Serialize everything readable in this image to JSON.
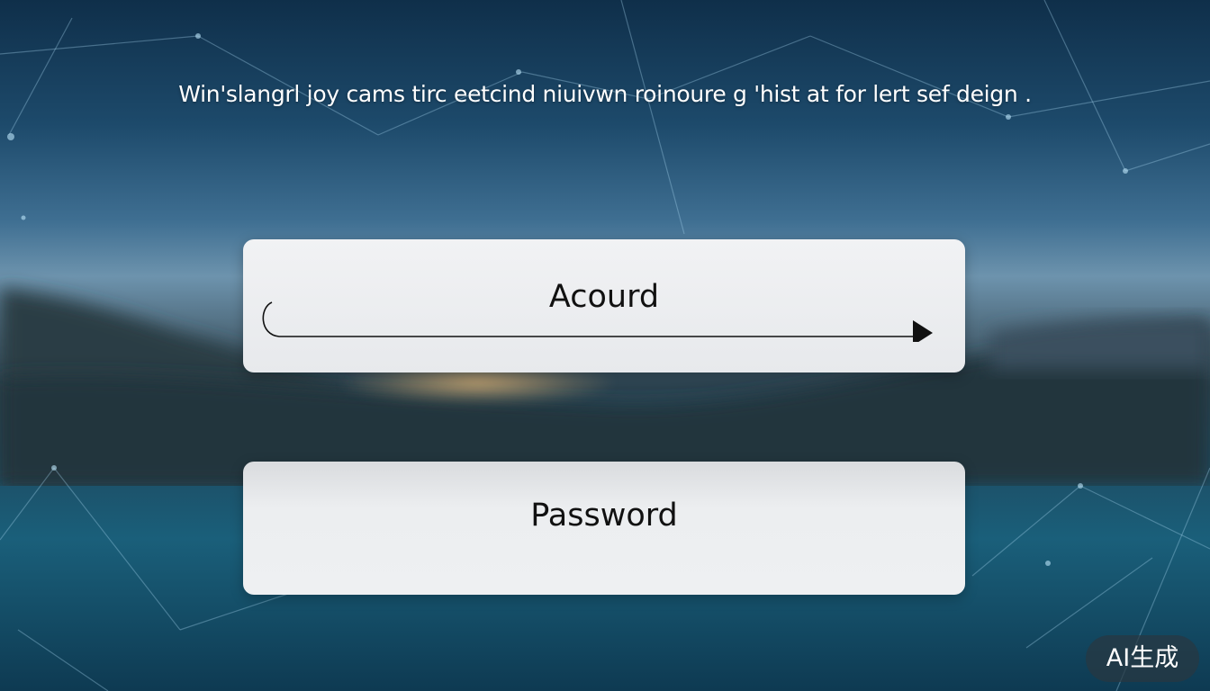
{
  "headline": "Win'slangrl joy cams tirc eetcind niuivwn roinoure g 'hist at for lert sef deign .",
  "account_field": {
    "label": "Acourd"
  },
  "password_field": {
    "label": "Password"
  },
  "badge": {
    "label": "AI生成"
  },
  "icons": {
    "arrow": "right-arrow-icon"
  },
  "colors": {
    "field_background": "#eceef0",
    "label_text": "#111111",
    "headline_text": "#ffffff",
    "badge_background": "#2c3a44"
  }
}
